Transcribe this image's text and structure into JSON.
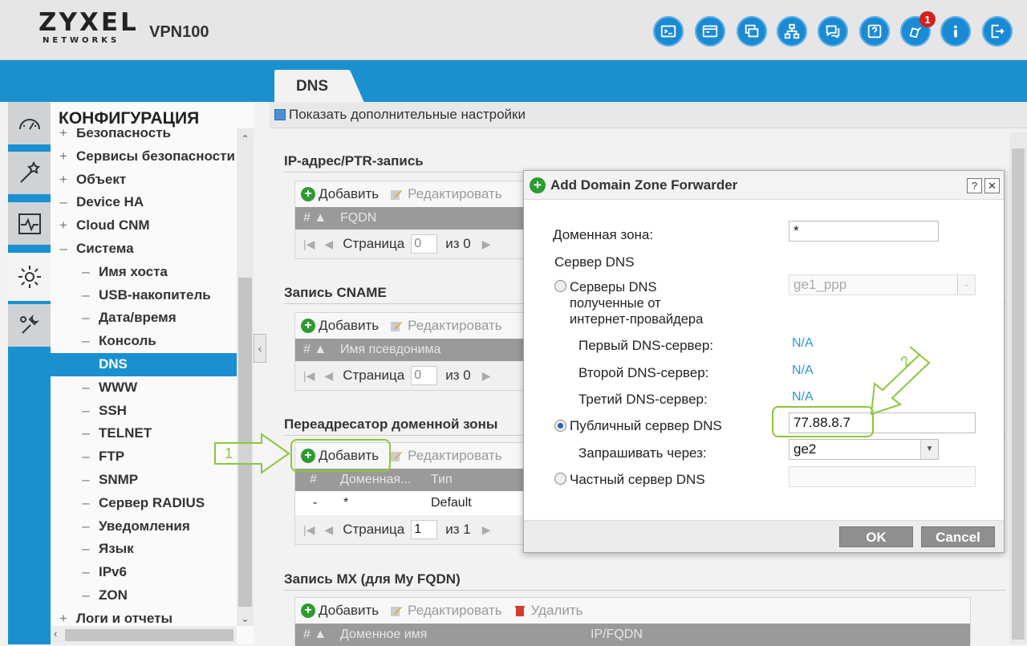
{
  "header": {
    "brand": "ZYXEL",
    "brand_sub": "NETWORKS",
    "model": "VPN100",
    "notification_count": "1"
  },
  "tab": {
    "label": "DNS"
  },
  "nav": {
    "title": "КОНФИГУРАЦИЯ",
    "items": [
      {
        "prefix": "+",
        "label": "Безопасность"
      },
      {
        "prefix": "+",
        "label": "Сервисы безопасности"
      },
      {
        "prefix": "+",
        "label": "Объект"
      },
      {
        "prefix": "–",
        "label": "Device HA"
      },
      {
        "prefix": "+",
        "label": "Cloud CNM"
      },
      {
        "prefix": "–",
        "label": "Система"
      },
      {
        "prefix": "–",
        "label": "Имя хоста"
      },
      {
        "prefix": "–",
        "label": "USB-накопитель"
      },
      {
        "prefix": "–",
        "label": "Дата/время"
      },
      {
        "prefix": "–",
        "label": "Консоль"
      },
      {
        "prefix": "",
        "label": "DNS"
      },
      {
        "prefix": "–",
        "label": "WWW"
      },
      {
        "prefix": "–",
        "label": "SSH"
      },
      {
        "prefix": "–",
        "label": "TELNET"
      },
      {
        "prefix": "–",
        "label": "FTP"
      },
      {
        "prefix": "–",
        "label": "SNMP"
      },
      {
        "prefix": "–",
        "label": "Сервер RADIUS"
      },
      {
        "prefix": "–",
        "label": "Уведомления"
      },
      {
        "prefix": "–",
        "label": "Язык"
      },
      {
        "prefix": "–",
        "label": "IPv6"
      },
      {
        "prefix": "–",
        "label": "ZON"
      },
      {
        "prefix": "+",
        "label": "Логи и отчеты"
      }
    ]
  },
  "main": {
    "advanced_link": "Показать дополнительные настройки",
    "add": "Добавить",
    "edit": "Редактировать",
    "delete": "Удалить",
    "page": "Страница",
    "sections": {
      "ptr": {
        "title": "IP-адрес/PTR-запись",
        "col_num": "# ▲",
        "col1": "FQDN",
        "page_value": "0",
        "page_of": "из 0"
      },
      "cname": {
        "title": "Запись CNAME",
        "col_num": "# ▲",
        "col1": "Имя псевдонима",
        "page_value": "0",
        "page_of": "из 0"
      },
      "forwarder": {
        "title": "Переадресатор доменной зоны",
        "col_num": "#",
        "col1": "Доменная...",
        "col2": "Тип",
        "row": {
          "num": "-",
          "zone": "*",
          "type": "Default"
        },
        "page_value": "1",
        "page_of": "из 1"
      },
      "mx": {
        "title": "Запись MX (для My FQDN)",
        "col_num": "# ▲",
        "col1": "Доменное имя",
        "col2": "IP/FQDN"
      }
    }
  },
  "annotations": {
    "step1": "1",
    "step2": "2"
  },
  "dialog": {
    "title": "Add Domain Zone Forwarder",
    "help": "?",
    "close": "✕",
    "domain_zone_label": "Доменная зона:",
    "domain_zone_value": "*",
    "dns_server_label": "Сервер DNS",
    "isp_radio_label": "Серверы DNS\nполученные от\nинтернет-провайдера",
    "isp_select_value": "ge1_ppp",
    "first_dns_label": "Первый DNS-сервер:",
    "first_dns_value": "N/A",
    "second_dns_label": "Второй DNS-сервер:",
    "second_dns_value": "N/A",
    "third_dns_label": "Третий DNS-сервер:",
    "third_dns_value": "N/A",
    "public_radio_label": "Публичный сервер DNS",
    "public_value": "77.88.8.7",
    "query_via_label": "Запрашивать через:",
    "query_via_value": "ge2",
    "private_radio_label": "Частный сервер DNS",
    "private_value": "",
    "ok": "OK",
    "cancel": "Cancel"
  }
}
